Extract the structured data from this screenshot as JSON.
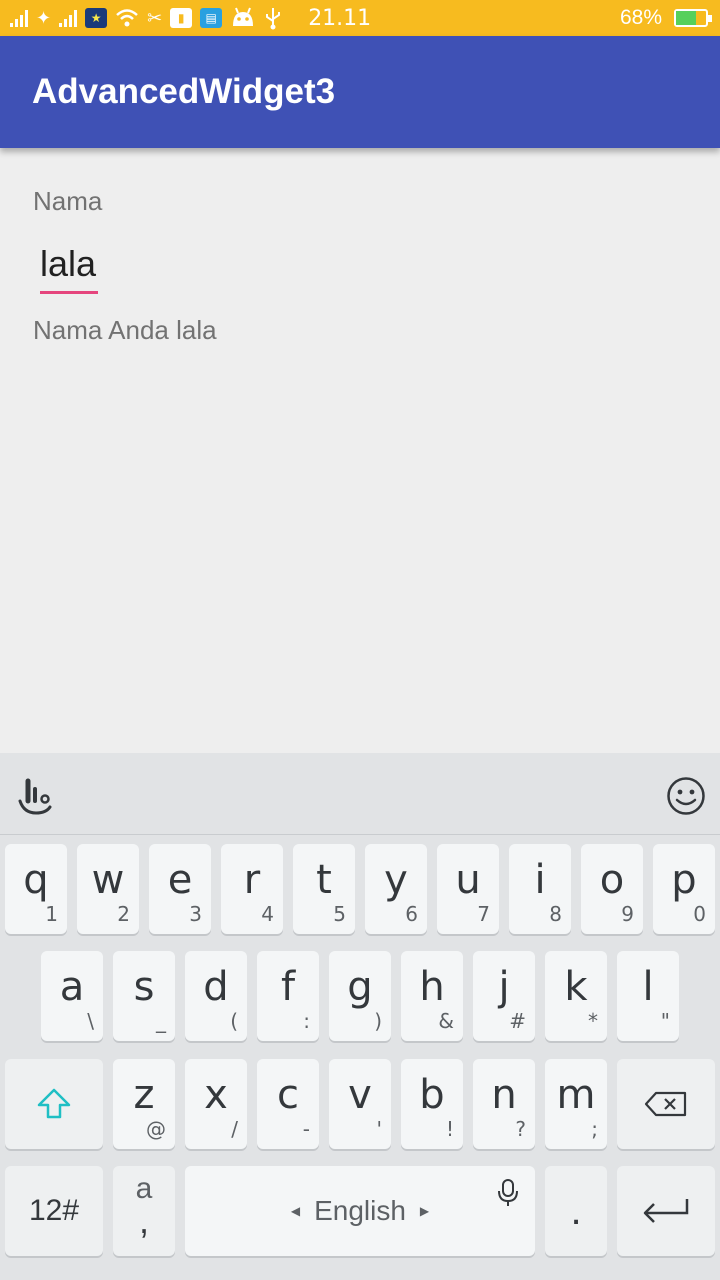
{
  "status_bar": {
    "time": "21.11",
    "battery_percent": "68%",
    "icons": [
      "signal-icon",
      "cell-carrier-icon",
      "signal-icon",
      "bluetooth-star-icon",
      "wifi-icon",
      "tool-icon",
      "battery-saver-icon",
      "message-icon",
      "android-icon",
      "usb-icon"
    ]
  },
  "app_bar": {
    "title": "AdvancedWidget3"
  },
  "form": {
    "label": "Nama",
    "input_value": "lala",
    "result": "Nama Anda lala"
  },
  "keyboard": {
    "row1": [
      {
        "k": "q",
        "s": "1"
      },
      {
        "k": "w",
        "s": "2"
      },
      {
        "k": "e",
        "s": "3"
      },
      {
        "k": "r",
        "s": "4"
      },
      {
        "k": "t",
        "s": "5"
      },
      {
        "k": "y",
        "s": "6"
      },
      {
        "k": "u",
        "s": "7"
      },
      {
        "k": "i",
        "s": "8"
      },
      {
        "k": "o",
        "s": "9"
      },
      {
        "k": "p",
        "s": "0"
      }
    ],
    "row2": [
      {
        "k": "a",
        "s": "\\"
      },
      {
        "k": "s",
        "s": "_"
      },
      {
        "k": "d",
        "s": "("
      },
      {
        "k": "f",
        "s": ":"
      },
      {
        "k": "g",
        "s": ")"
      },
      {
        "k": "h",
        "s": "&"
      },
      {
        "k": "j",
        "s": "#"
      },
      {
        "k": "k",
        "s": "*"
      },
      {
        "k": "l",
        "s": "\""
      }
    ],
    "row3": [
      {
        "k": "z",
        "s": "@"
      },
      {
        "k": "x",
        "s": "/"
      },
      {
        "k": "c",
        "s": "-"
      },
      {
        "k": "v",
        "s": "'"
      },
      {
        "k": "b",
        "s": "!"
      },
      {
        "k": "n",
        "s": "?"
      },
      {
        "k": "m",
        "s": ";"
      }
    ],
    "num_key": "12#",
    "comma_key_top": "a",
    "comma_key_bottom": ",",
    "space_label": "English",
    "period_key": "."
  }
}
